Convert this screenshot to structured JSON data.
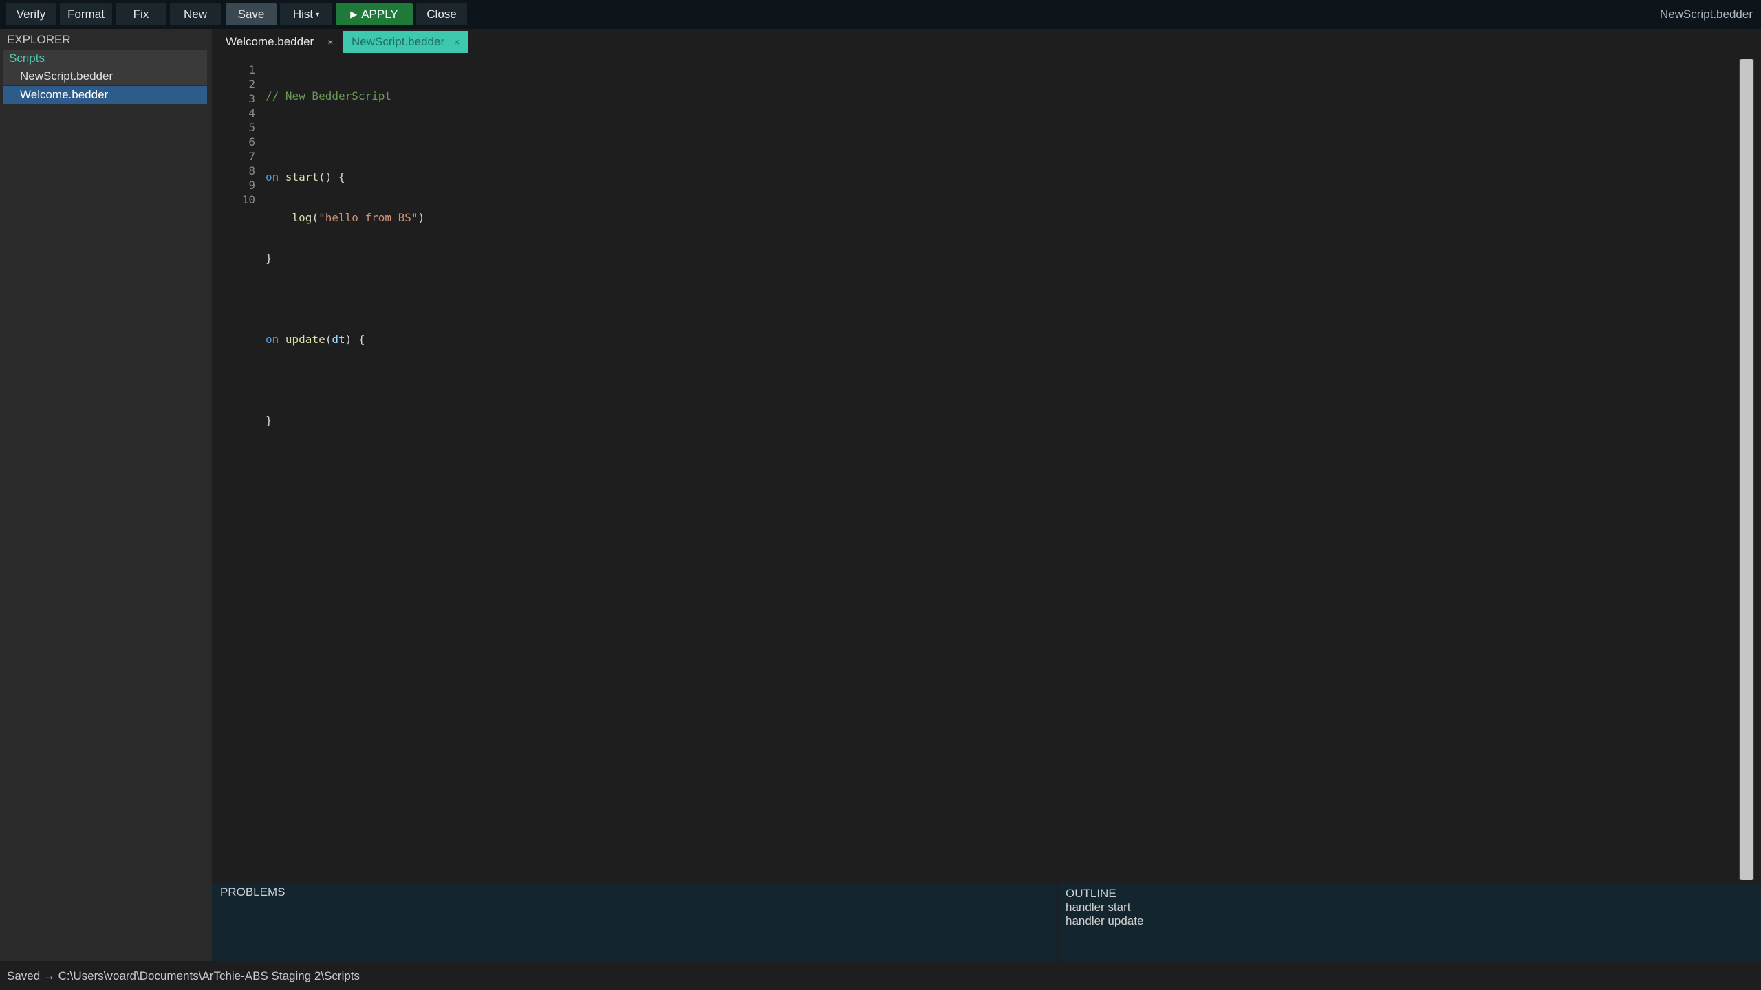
{
  "toolbar": {
    "buttons": {
      "verify": "Verify",
      "format": "Format",
      "fix": "Fix",
      "new": "New",
      "save": "Save",
      "hist": "Hist",
      "apply": "APPLY",
      "close": "Close"
    },
    "hist_caret": "▾",
    "apply_icon": "▶",
    "window_title": "NewScript.bedder"
  },
  "explorer": {
    "header": "EXPLORER",
    "folder": "Scripts",
    "files": [
      "NewScript.bedder",
      "Welcome.bedder"
    ],
    "selected_file": "Welcome.bedder"
  },
  "tabs": [
    {
      "label": "Welcome.bedder",
      "close": "×",
      "active": false
    },
    {
      "label": "NewScript.bedder",
      "close": "×",
      "active": true
    }
  ],
  "editor": {
    "line_numbers": [
      "1",
      "2",
      "3",
      "4",
      "5",
      "6",
      "7",
      "8",
      "9",
      "10"
    ],
    "code": {
      "l1_comment": "// New BedderScript",
      "l3_kw": "on",
      "l3_fn": "start",
      "l3_rest": "() {",
      "l4_fn": "log",
      "l4_open": "(",
      "l4_str": "\"hello from BS\"",
      "l4_close": ")",
      "l5_brace": "}",
      "l7_kw": "on",
      "l7_fn": "update",
      "l7_open": "(",
      "l7_param": "dt",
      "l7_close": ") {",
      "l9_brace": "}"
    }
  },
  "panels": {
    "problems_title": "PROBLEMS",
    "outline_title": "OUTLINE",
    "outline_items": [
      "handler start",
      "handler update"
    ]
  },
  "status": {
    "text": "Saved → C:\\Users\\voard\\Documents\\ArTchie-ABS Staging 2\\Scripts"
  },
  "colors": {
    "apply_button": "#1f7a3a",
    "active_tab": "#3ec9ae",
    "selected_file": "#2d5b8a",
    "folder_label": "#4ec9b0",
    "panel_bg": "#132630"
  }
}
